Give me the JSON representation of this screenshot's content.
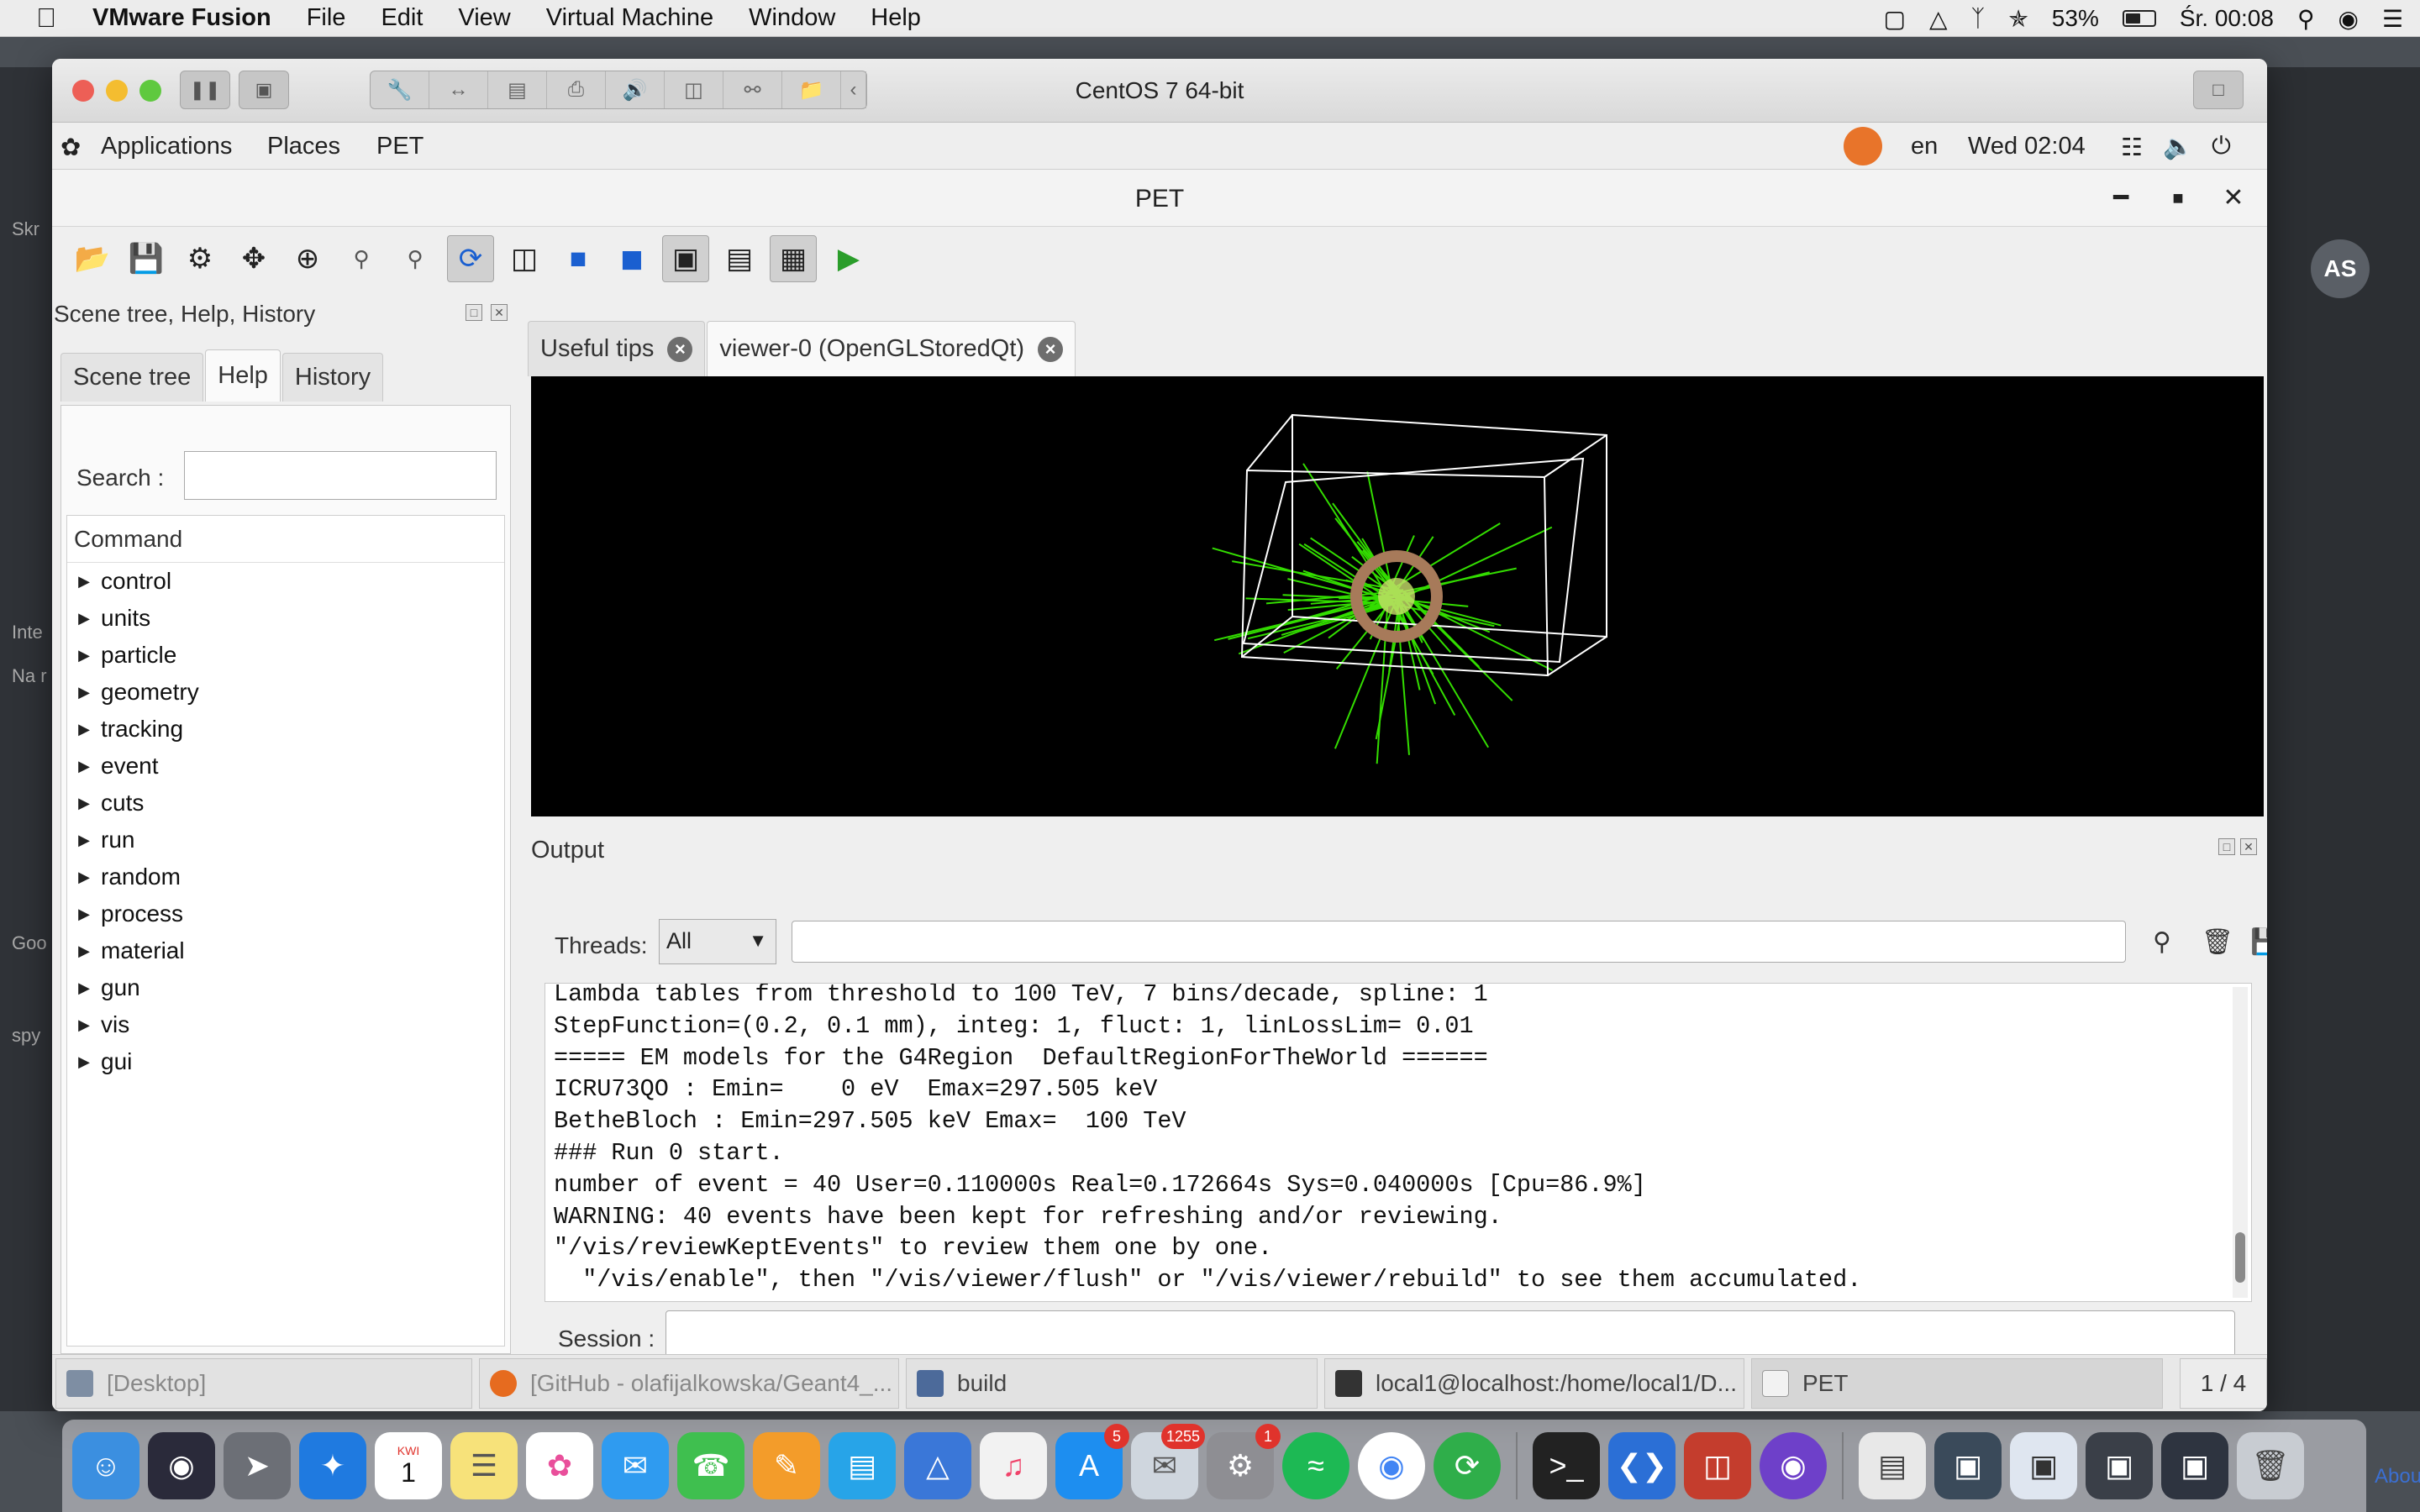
{
  "mac_menubar": {
    "app_name": "VMware Fusion",
    "menus": [
      "File",
      "Edit",
      "View",
      "Virtual Machine",
      "Window",
      "Help"
    ],
    "battery_percent": "53%",
    "battery_level": 0.53,
    "clock": "Śr. 00:08"
  },
  "vm_window": {
    "title": "CentOS 7 64-bit"
  },
  "gnome_topbar": {
    "applications": "Applications",
    "places": "Places",
    "pet": "PET",
    "language": "en",
    "datetime": "Wed 02:04"
  },
  "pet_window": {
    "title": "PET"
  },
  "left_panel": {
    "title": "Scene tree, Help, History",
    "tabs": [
      "Scene tree",
      "Help",
      "History"
    ],
    "selected_tab": "Help",
    "search_label": "Search :",
    "search_value": "",
    "tree_header": "Command",
    "commands": [
      "control",
      "units",
      "particle",
      "geometry",
      "tracking",
      "event",
      "cuts",
      "run",
      "random",
      "process",
      "material",
      "gun",
      "vis",
      "gui"
    ]
  },
  "viewer": {
    "tabs": [
      "Useful tips",
      "viewer-0 (OpenGLStoredQt)"
    ],
    "selected_tab": "viewer-0 (OpenGLStoredQt)"
  },
  "output": {
    "title": "Output",
    "threads_label": "Threads:",
    "threads_value": "All",
    "filter_value": "",
    "lines": [
      "Lambda tables from threshold to 100 TeV, 7 bins/decade, spline: 1",
      "StepFunction=(0.2, 0.1 mm), integ: 1, fluct: 1, linLossLim= 0.01",
      "===== EM models for the G4Region  DefaultRegionForTheWorld ======",
      "ICRU73QO : Emin=    0 eV  Emax=297.505 keV",
      "BetheBloch : Emin=297.505 keV Emax=  100 TeV",
      "### Run 0 start.",
      "number of event = 40 User=0.110000s Real=0.172664s Sys=0.040000s [Cpu=86.9%]",
      "WARNING: 40 events have been kept for refreshing and/or reviewing.",
      "\"/vis/reviewKeptEvents\" to review them one by one.",
      "  \"/vis/enable\", then \"/vis/viewer/flush\" or \"/vis/viewer/rebuild\" to see them accumulated."
    ],
    "session_label": "Session :",
    "session_value": ""
  },
  "taskbar": {
    "tasks": [
      "[Desktop]",
      "[GitHub - olafijalkowska/Geant4_...",
      "build",
      "local1@localhost:/home/local1/D...",
      "PET"
    ],
    "workspace": "1 / 4"
  },
  "background": {
    "avatar_initials": "AS",
    "left_fragments": [
      "Skr",
      "Inte",
      "Na r",
      "Goo",
      "spy"
    ],
    "about_link": "Abou"
  },
  "dock": {
    "calendar_month": "KWI",
    "calendar_day": "1",
    "badges": {
      "app_store": "5",
      "mail": "1255",
      "system_prefs": "1"
    }
  },
  "colors": {
    "viewer_background": "#000000",
    "wireframe": "#ffffff",
    "tracks": "#33dd00",
    "accent_blue": "#1a5fd0"
  }
}
